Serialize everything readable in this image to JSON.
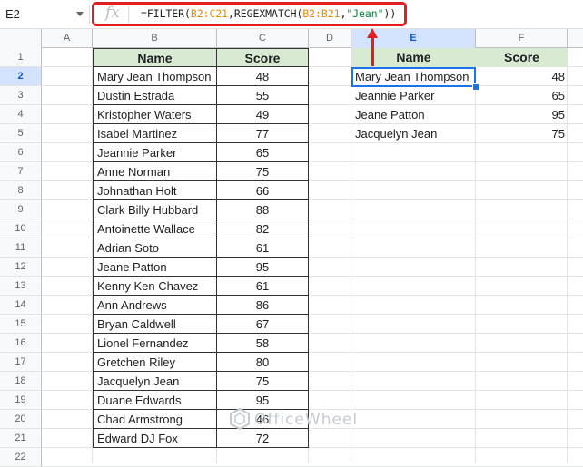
{
  "name_box": "E2",
  "formula": {
    "prefix": "=FILTER(",
    "range1": "B2:C21",
    "mid": ",REGEXMATCH(",
    "range2": "B2:B21",
    "comma": ",",
    "string": "\"Jean\"",
    "suffix": "))"
  },
  "columns": [
    "A",
    "B",
    "C",
    "D",
    "E",
    "F"
  ],
  "active_column": "E",
  "rows": [
    "1",
    "2",
    "3",
    "4",
    "5",
    "6",
    "7",
    "8",
    "9",
    "10",
    "11",
    "12",
    "13",
    "14",
    "15",
    "16",
    "17",
    "18",
    "19",
    "20",
    "21",
    "22"
  ],
  "active_row": "2",
  "source_table": {
    "headers": [
      "Name",
      "Score"
    ],
    "rows": [
      [
        "Mary Jean Thompson",
        "48"
      ],
      [
        "Dustin Estrada",
        "55"
      ],
      [
        "Kristopher Waters",
        "49"
      ],
      [
        "Isabel Martinez",
        "77"
      ],
      [
        "Jeannie Parker",
        "65"
      ],
      [
        "Anne Norman",
        "75"
      ],
      [
        "Johnathan Holt",
        "66"
      ],
      [
        "Clark Billy Hubbard",
        "88"
      ],
      [
        "Antoinette Wallace",
        "82"
      ],
      [
        "Adrian Soto",
        "61"
      ],
      [
        "Jeane Patton",
        "95"
      ],
      [
        "Kenny Ken Chavez",
        "61"
      ],
      [
        "Ann Andrews",
        "86"
      ],
      [
        "Bryan Caldwell",
        "67"
      ],
      [
        "Lionel Fernandez",
        "58"
      ],
      [
        "Gretchen Riley",
        "80"
      ],
      [
        "Jacquelyn Jean",
        "75"
      ],
      [
        "Duane Edwards",
        "95"
      ],
      [
        "Chad Armstrong",
        "46"
      ],
      [
        "Edward DJ Fox",
        "72"
      ]
    ]
  },
  "result_table": {
    "headers": [
      "Name",
      "Score"
    ],
    "rows": [
      [
        "Mary Jean Thompson",
        "48"
      ],
      [
        "Jeannie Parker",
        "65"
      ],
      [
        "Jeane Patton",
        "95"
      ],
      [
        "Jacquelyn Jean",
        "75"
      ]
    ]
  },
  "watermark": "OfficeWheel",
  "colors": {
    "header_fill": "#d9ead3",
    "highlight_red": "#e02020",
    "selection_blue": "#1a73e8"
  }
}
